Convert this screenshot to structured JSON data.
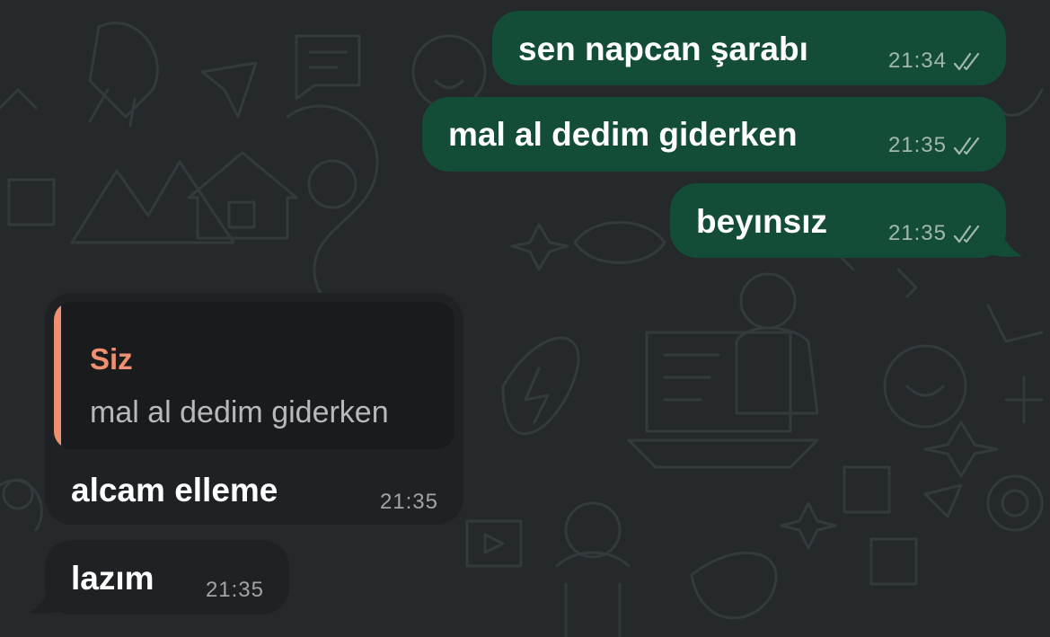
{
  "theme": {
    "background": "#25292b",
    "outgoing_bubble": "#134d37",
    "incoming_bubble": "#1f2224",
    "quote_accent": "#ef9171",
    "read_ticks": "#a3b7ae"
  },
  "messages": [
    {
      "direction": "outgoing",
      "text": "sen napcan şarabı",
      "time": "21:34",
      "status_icon": "double-check-icon"
    },
    {
      "direction": "outgoing",
      "text": "mal al dedim giderken",
      "time": "21:35",
      "status_icon": "double-check-icon"
    },
    {
      "direction": "outgoing",
      "text": "beyınsız",
      "time": "21:35",
      "status_icon": "double-check-icon"
    },
    {
      "direction": "incoming",
      "reply_to": {
        "author": "Siz",
        "text": "mal al dedim giderken"
      },
      "text": "alcam elleme",
      "time": "21:35"
    },
    {
      "direction": "incoming",
      "text": "lazım",
      "time": "21:35"
    }
  ]
}
